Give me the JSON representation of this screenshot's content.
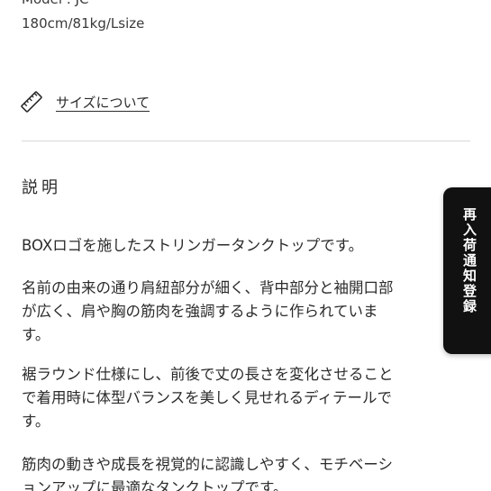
{
  "model": {
    "name": "Model : JC",
    "spec": "180cm/81kg/Lsize"
  },
  "size_link": {
    "icon": "ruler-icon",
    "label": "サイズについて"
  },
  "description": {
    "title": "説明",
    "paragraphs": [
      [
        "BOXロゴを施したストリンガータンクトップです。"
      ],
      [
        "名前の由来の通り肩紐部分が細く、背中部分と袖開口部",
        "が広く、肩や胸の筋肉を強調するように作られていま",
        "す。"
      ],
      [
        "裾ラウンド仕様にし、前後で丈の長さを変化させること",
        "で着用時に体型バランスを美しく見せれるディテールで",
        "す。"
      ],
      [
        "筋肉の動きや成長を視覚的に認識しやすく、モチベーシ",
        "ョンアップに最適なタンクトップです。"
      ]
    ]
  },
  "restock_tab": {
    "label": "再入荷通知登録"
  },
  "colors": {
    "text": "#2b2b2b",
    "divider": "#d9d9d9",
    "tab_background": "#111111",
    "tab_text": "#ffffff"
  }
}
